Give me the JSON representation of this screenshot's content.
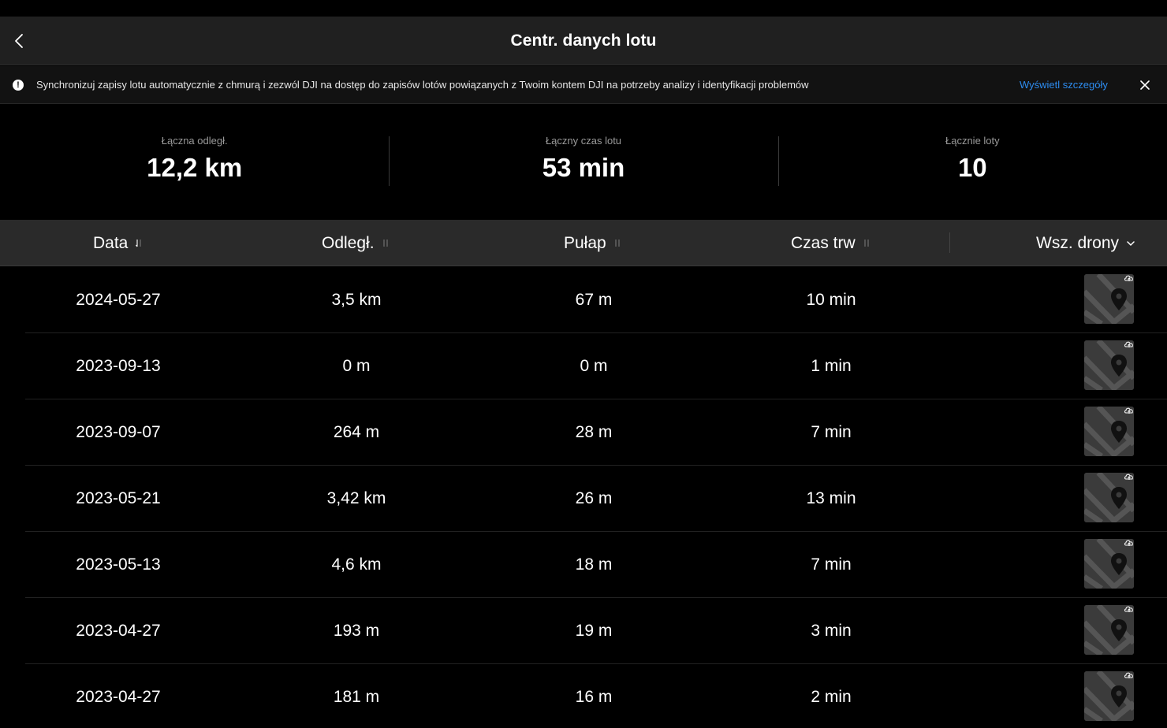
{
  "header": {
    "title": "Centr. danych lotu"
  },
  "banner": {
    "text": "Synchronizuj zapisy lotu automatycznie z chmurą i zezwól DJI na dostęp do zapisów lotów powiązanych z Twoim kontem DJI na potrzeby analizy i identyfikacji problemów",
    "link": "Wyświetl szczegóły",
    "icon": "exclamation-icon"
  },
  "stats": {
    "distance_label": "Łączna odległ.",
    "distance_value": "12,2 km",
    "time_label": "Łączny czas lotu",
    "time_value": "53 min",
    "flights_label": "Łącznie loty",
    "flights_value": "10"
  },
  "table": {
    "columns": {
      "date": "Data",
      "distance": "Odległ.",
      "altitude": "Pułap",
      "duration": "Czas trw",
      "drones": "Wsz. drony"
    },
    "rows": [
      {
        "date": "2024-05-27",
        "distance": "3,5 km",
        "altitude": "67 m",
        "duration": "10 min"
      },
      {
        "date": "2023-09-13",
        "distance": "0 m",
        "altitude": "0 m",
        "duration": "1 min"
      },
      {
        "date": "2023-09-07",
        "distance": "264 m",
        "altitude": "28 m",
        "duration": "7 min"
      },
      {
        "date": "2023-05-21",
        "distance": "3,42 km",
        "altitude": "26 m",
        "duration": "13 min"
      },
      {
        "date": "2023-05-13",
        "distance": "4,6 km",
        "altitude": "18 m",
        "duration": "7 min"
      },
      {
        "date": "2023-04-27",
        "distance": "193 m",
        "altitude": "19 m",
        "duration": "3 min"
      },
      {
        "date": "2023-04-27",
        "distance": "181 m",
        "altitude": "16 m",
        "duration": "2 min"
      }
    ]
  },
  "colors": {
    "accent_link": "#2d8cf0",
    "background": "#000000",
    "header_bg": "#202020",
    "table_head_bg": "#2a2a2a"
  }
}
